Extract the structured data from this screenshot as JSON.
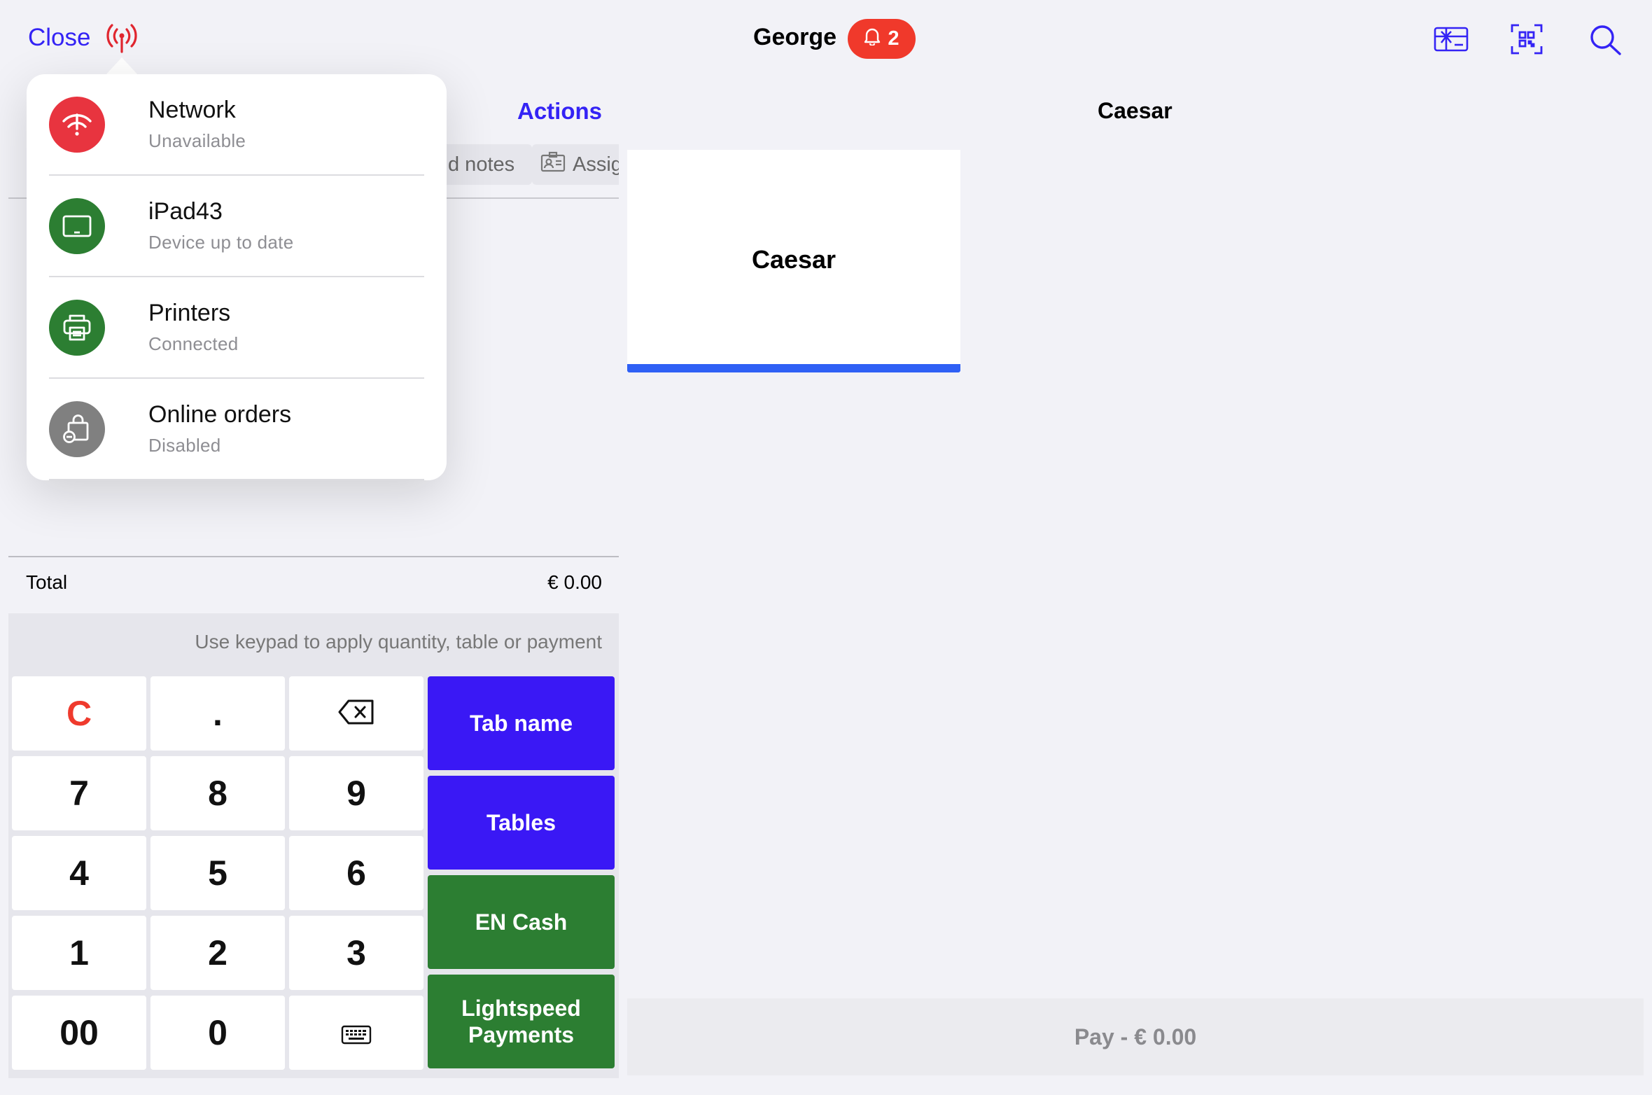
{
  "header": {
    "close_label": "Close",
    "user_name": "George",
    "notification_count": "2",
    "icons": [
      "antenna-icon",
      "bell-icon",
      "gift-card-icon",
      "qr-scan-icon",
      "search-icon"
    ]
  },
  "order": {
    "actions_label": "Actions",
    "chips": [
      {
        "label": "d notes",
        "icon": ""
      },
      {
        "label": "Assig",
        "icon": "assign-icon"
      }
    ],
    "total_label": "Total",
    "total_value": "€ 0.00"
  },
  "keypad": {
    "hint": "Use keypad to apply quantity, table or payment",
    "keys": [
      "C",
      ".",
      "backspace",
      "7",
      "8",
      "9",
      "4",
      "5",
      "6",
      "1",
      "2",
      "3",
      "00",
      "0",
      "keyboard"
    ]
  },
  "actions": [
    {
      "label": "Tab name",
      "color": "#3a18f5"
    },
    {
      "label": "Tables",
      "color": "#3a18f5"
    },
    {
      "label": "EN Cash",
      "color": "#2c7e32"
    },
    {
      "label": "Lightspeed Payments",
      "color": "#2c7e32"
    }
  ],
  "menu": {
    "section_title": "Caesar",
    "category": "Caesar",
    "pay_label": "Pay - € 0.00"
  },
  "status_popover": {
    "items": [
      {
        "title": "Network",
        "subtitle": "Unavailable",
        "color": "#e8343f",
        "icon": "wifi-off-icon"
      },
      {
        "title": "iPad43",
        "subtitle": "Device up to date",
        "color": "#2c7e32",
        "icon": "tablet-icon"
      },
      {
        "title": "Printers",
        "subtitle": "Connected",
        "color": "#2c7e32",
        "icon": "printer-icon"
      },
      {
        "title": "Online orders",
        "subtitle": "Disabled",
        "color": "#808080",
        "icon": "shopping-bag-icon"
      }
    ]
  },
  "colors": {
    "accent": "#3423f5",
    "danger": "#ef3a2d",
    "success": "#2c7e32",
    "card_bar": "#2f60f5"
  }
}
